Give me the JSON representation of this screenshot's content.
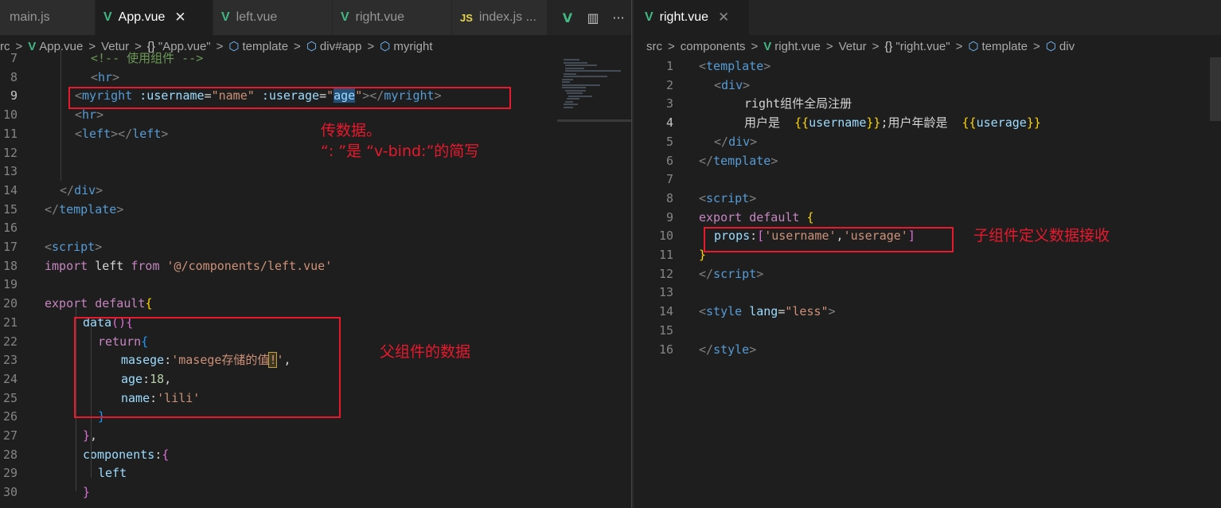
{
  "left_pane": {
    "tabs": [
      {
        "label": "main.js",
        "icon": "js-file-icon",
        "badge": ""
      },
      {
        "label": "App.vue",
        "icon": "vue-file-icon",
        "close": "✕"
      },
      {
        "label": "left.vue",
        "icon": "vue-file-icon"
      },
      {
        "label": "right.vue",
        "icon": "vue-file-icon"
      },
      {
        "label": "index.js ...",
        "icon": "js-file-icon",
        "badge": "JS"
      }
    ],
    "breadcrumb": [
      "rc",
      "App.vue",
      "Vetur",
      "\"App.vue\"",
      "template",
      "div#app",
      "myright"
    ],
    "annotations": {
      "pass_data": "传数据。",
      "shorthand": "“: ”是 “v-bind:”的简写",
      "parent_data": "父组件的数据"
    }
  },
  "right_pane": {
    "tab": {
      "label": "right.vue",
      "close": "✕"
    },
    "breadcrumb": [
      "src",
      "components",
      "right.vue",
      "Vetur",
      "\"right.vue\"",
      "template",
      "div"
    ],
    "annotations": {
      "props_receive": "子组件定义数据接收"
    }
  },
  "icons": {
    "vue": "V",
    "js": "JS",
    "braces": "{}",
    "cube": "⬡",
    "split": "▥",
    "more": "···"
  },
  "colors": {
    "annotation_red": "#e8192c",
    "vue_green": "#41b883",
    "editor_bg": "#1e1e1e"
  }
}
